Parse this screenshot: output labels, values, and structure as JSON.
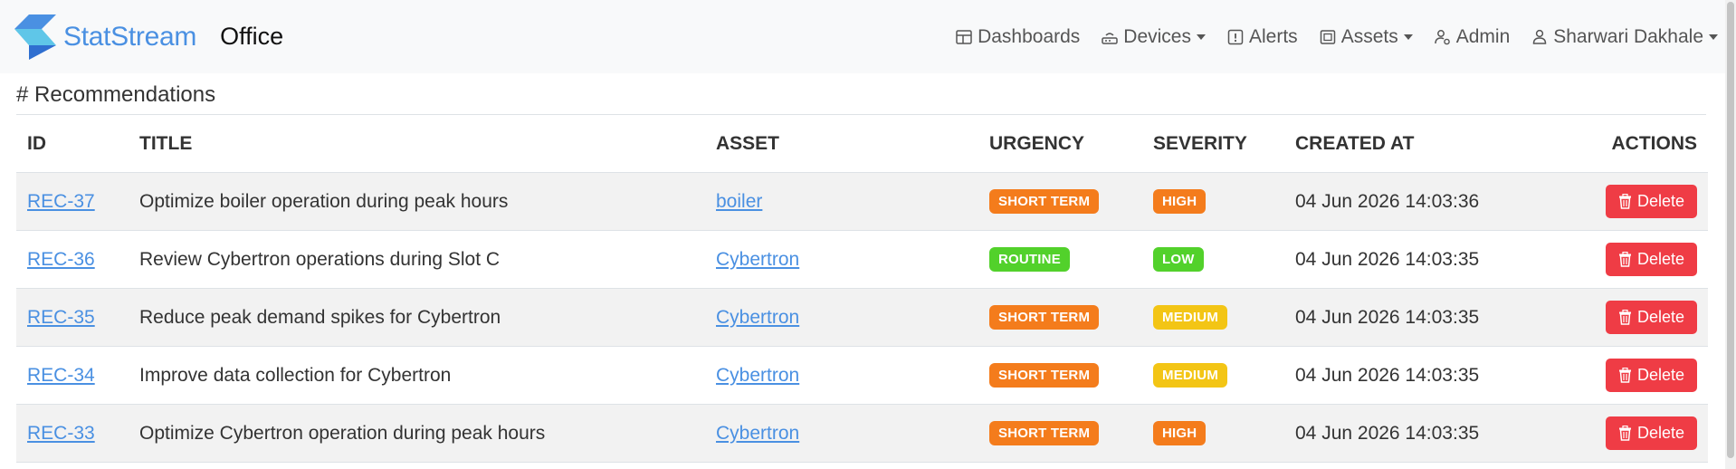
{
  "app": {
    "brand": "StatStream",
    "context": "Office"
  },
  "nav": {
    "dashboards": "Dashboards",
    "devices": "Devices",
    "alerts": "Alerts",
    "assets": "Assets",
    "admin": "Admin",
    "user": "Sharwari Dakhale"
  },
  "section": {
    "heading": "# Recommendations"
  },
  "table": {
    "headers": {
      "id": "ID",
      "title": "TITLE",
      "asset": "ASSET",
      "urgency": "URGENCY",
      "severity": "SEVERITY",
      "created": "CREATED AT",
      "actions": "ACTIONS"
    },
    "delete_label": "Delete",
    "rows": [
      {
        "id": "REC-37",
        "title": "Optimize boiler operation during peak hours",
        "asset": "boiler",
        "urgency": "SHORT TERM",
        "severity": "HIGH",
        "created": "04 Jun 2026 14:03:36"
      },
      {
        "id": "REC-36",
        "title": "Review Cybertron operations during Slot C",
        "asset": "Cybertron",
        "urgency": "ROUTINE",
        "severity": "LOW",
        "created": "04 Jun 2026 14:03:35"
      },
      {
        "id": "REC-35",
        "title": "Reduce peak demand spikes for Cybertron",
        "asset": "Cybertron",
        "urgency": "SHORT TERM",
        "severity": "MEDIUM",
        "created": "04 Jun 2026 14:03:35"
      },
      {
        "id": "REC-34",
        "title": "Improve data collection for Cybertron",
        "asset": "Cybertron",
        "urgency": "SHORT TERM",
        "severity": "MEDIUM",
        "created": "04 Jun 2026 14:03:35"
      },
      {
        "id": "REC-33",
        "title": "Optimize Cybertron operation during peak hours",
        "asset": "Cybertron",
        "urgency": "SHORT TERM",
        "severity": "HIGH",
        "created": "04 Jun 2026 14:03:35"
      }
    ]
  },
  "colors": {
    "brand": "#4a90e2",
    "link": "#4a90e2",
    "SHORT TERM": "#f47c1c",
    "ROUTINE": "#52d12b",
    "HIGH": "#f47c1c",
    "MEDIUM": "#f3c515",
    "LOW": "#52d12b",
    "delete": "#ef3c45"
  },
  "icons": {
    "dashboards": "layout-grid-icon",
    "devices": "router-icon",
    "alerts": "alert-square-icon",
    "assets": "asset-box-icon",
    "admin": "user-gear-icon",
    "user": "user-icon",
    "delete": "trash-icon"
  }
}
